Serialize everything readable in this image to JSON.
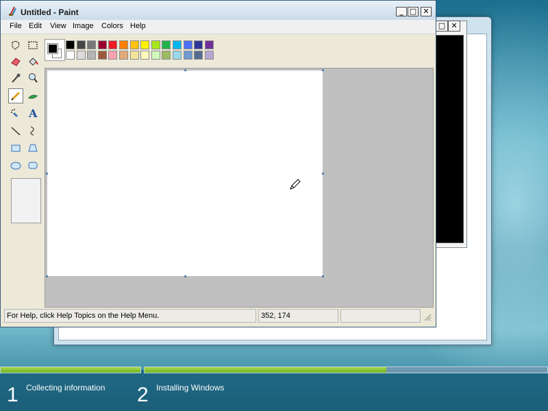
{
  "paint": {
    "title": "Untitled - Paint",
    "menu": [
      "File",
      "Edit",
      "View",
      "Image",
      "Colors",
      "Help"
    ],
    "tools": [
      {
        "name": "free-form-select-tool",
        "icon": "freeform-select-icon"
      },
      {
        "name": "select-tool",
        "icon": "rect-select-icon"
      },
      {
        "name": "eraser-tool",
        "icon": "eraser-icon"
      },
      {
        "name": "fill-tool",
        "icon": "paint-bucket-icon"
      },
      {
        "name": "pick-color-tool",
        "icon": "eyedropper-icon"
      },
      {
        "name": "magnifier-tool",
        "icon": "magnifier-icon"
      },
      {
        "name": "pencil-tool",
        "icon": "pencil-icon",
        "selected": true
      },
      {
        "name": "brush-tool",
        "icon": "brush-icon"
      },
      {
        "name": "airbrush-tool",
        "icon": "airbrush-icon"
      },
      {
        "name": "text-tool",
        "icon": "text-icon",
        "label": "A"
      },
      {
        "name": "line-tool",
        "icon": "line-icon"
      },
      {
        "name": "curve-tool",
        "icon": "curve-icon"
      },
      {
        "name": "rectangle-tool",
        "icon": "rectangle-icon"
      },
      {
        "name": "polygon-tool",
        "icon": "polygon-icon"
      },
      {
        "name": "ellipse-tool",
        "icon": "ellipse-icon"
      },
      {
        "name": "rounded-rectangle-tool",
        "icon": "rounded-rect-icon"
      }
    ],
    "colors": {
      "foreground": "#000000",
      "background": "#ffffff",
      "palette_top": [
        "#000000",
        "#464646",
        "#787878",
        "#990030",
        "#ed1c24",
        "#ff7e00",
        "#ffc20e",
        "#fff200",
        "#a8e61d",
        "#22b14c",
        "#00b7ef",
        "#4d6df3",
        "#2f3699",
        "#6f3198"
      ],
      "palette_bottom": [
        "#ffffff",
        "#dcdcdc",
        "#b4b4b4",
        "#9c5a3c",
        "#ffa3b1",
        "#e5aa7a",
        "#f5e49c",
        "#fff9bd",
        "#d3f9bc",
        "#9dbb61",
        "#99d9ea",
        "#709ad1",
        "#546d8e",
        "#b5a5d5"
      ]
    },
    "status": {
      "help": "For Help, click Help Topics on the Help Menu.",
      "coords": "352, 174",
      "size": ""
    }
  },
  "setup": {
    "steps": [
      {
        "number": "1",
        "label": "Collecting information"
      },
      {
        "number": "2",
        "label": "Installing Windows"
      }
    ],
    "progress": [
      {
        "fraction": 1.0
      },
      {
        "fraction": 0.6
      }
    ]
  }
}
